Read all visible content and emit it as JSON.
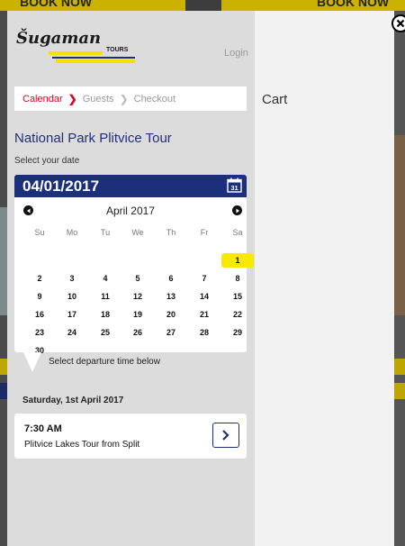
{
  "background": {
    "book_now_left": "BOOK NOW",
    "book_now_right": "BOOK NOW"
  },
  "header": {
    "logo_text": "Šugaman",
    "logo_suffix": "TOURS",
    "login": "Login"
  },
  "steps": [
    {
      "label": "Calendar",
      "active": true
    },
    {
      "label": "Guests",
      "active": false
    },
    {
      "label": "Checkout",
      "active": false
    }
  ],
  "tour": {
    "title": "National Park Plitvice Tour",
    "select_date_label": "Select your date",
    "selected_date": "04/01/2017"
  },
  "calendar": {
    "month_label": "April 2017",
    "weekdays": [
      "Su",
      "Mo",
      "Tu",
      "We",
      "Th",
      "Fr",
      "Sa"
    ],
    "first_weekday_index": 6,
    "days_in_month": 30,
    "selected_day": 1
  },
  "departure": {
    "hint": "Select departure time below",
    "date_heading": "Saturday, 1st April 2017",
    "options": [
      {
        "time": "7:30 AM",
        "name": "Plitvice Lakes Tour from Split"
      }
    ]
  },
  "cart": {
    "title": "Cart"
  },
  "icons": {
    "close": "close-icon",
    "calendar": "calendar-icon",
    "prev": "chevron-left-icon",
    "next": "chevron-right-icon",
    "step_sep": "chevron-right-icon"
  },
  "colors": {
    "brand_blue": "#1b2f7a",
    "accent_yellow": "#f7ea00",
    "active_step_red": "#c8102e"
  }
}
